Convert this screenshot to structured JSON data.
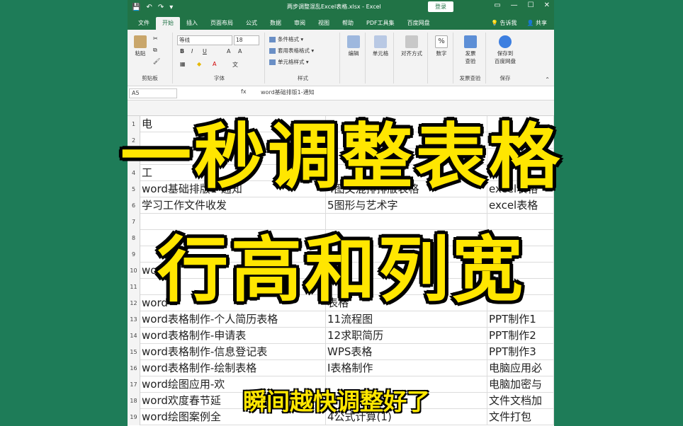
{
  "window": {
    "title": "两步调整混乱Excel表格.xlsx  -  Excel",
    "login_label": "登录",
    "controls": [
      "▭",
      "—",
      "☐",
      "✕"
    ]
  },
  "quick_access": [
    "💾",
    "↶",
    "↷",
    "▾"
  ],
  "tabs": [
    "文件",
    "开始",
    "插入",
    "页面布局",
    "公式",
    "数据",
    "审阅",
    "视图",
    "帮助",
    "PDF工具集",
    "百度网盘"
  ],
  "tabs_right": [
    "告诉我",
    "共享"
  ],
  "ribbon": {
    "clipboard": {
      "paste_label": "粘贴",
      "group_label": "剪贴板"
    },
    "font": {
      "font_name": "等线",
      "font_size": "18",
      "bold": "B",
      "italic": "I",
      "underline": "U",
      "a_up": "A",
      "a_down": "A",
      "group_label": "字体"
    },
    "styles": {
      "conditional": "条件格式",
      "table_format": "套用表格格式",
      "cell_styles": "单元格样式",
      "group_label": "样式"
    },
    "editing": {
      "label": "编辑"
    },
    "cells": {
      "label": "单元格"
    },
    "alignment": {
      "label": "对齐方式"
    },
    "number": {
      "label": "数字",
      "percent": "%"
    },
    "invoice": {
      "label_line1": "发票",
      "label_line2": "查验",
      "group_label": "发票查验"
    },
    "save_baidu": {
      "label_line1": "保存到",
      "label_line2": "百度网盘",
      "group_label": "保存"
    }
  },
  "formula_bar": {
    "namebox": "A5",
    "fx": "fx",
    "content": "word基础排版1-通知"
  },
  "grid": {
    "rows": [
      {
        "num": "1",
        "a": "电",
        "b": "",
        "c": ""
      },
      {
        "num": "2",
        "a": "",
        "b": "",
        "c": ""
      },
      {
        "num": "3",
        "a": "另",
        "b": "",
        "c": ""
      },
      {
        "num": "4",
        "a": "工",
        "b": "",
        "c": ""
      },
      {
        "num": "5",
        "a": "word基础排版1-通知",
        "b": "4图文混排排版表格",
        "c": "excel表格"
      },
      {
        "num": "6",
        "a": "学习工作文件收发",
        "b": "5图形与艺术字",
        "c": "excel表格"
      },
      {
        "num": "7",
        "a": "",
        "b": "",
        "c": ""
      },
      {
        "num": "8",
        "a": "",
        "b": "",
        "c": ""
      },
      {
        "num": "9",
        "a": "",
        "b": "",
        "c": ""
      },
      {
        "num": "10",
        "a": "wo",
        "b": "",
        "c": ""
      },
      {
        "num": "11",
        "a": "",
        "b": "",
        "c": ""
      },
      {
        "num": "12",
        "a": "word",
        "b": "表格",
        "c": ""
      },
      {
        "num": "13",
        "a": "word表格制作-个人简历表格",
        "b": "11流程图",
        "c": "PPT制作1"
      },
      {
        "num": "14",
        "a": "word表格制作-申请表",
        "b": "12求职简历",
        "c": "PPT制作2"
      },
      {
        "num": "15",
        "a": "word表格制作-信息登记表",
        "b": "WPS表格",
        "c": "PPT制作3"
      },
      {
        "num": "16",
        "a": "word表格制作-绘制表格",
        "b": "I表格制作",
        "c": "电脑应用必"
      },
      {
        "num": "17",
        "a": "word绘图应用-欢",
        "b": "",
        "c": "电脑加密与"
      },
      {
        "num": "18",
        "a": "word欢度春节延",
        "b": "",
        "c": "文件文档加"
      },
      {
        "num": "19",
        "a": "word绘图案例全",
        "b": "4公式计算(1)",
        "c": "文件打包"
      }
    ]
  },
  "overlay": {
    "headline_line1": "一秒调整表格",
    "headline_line2": "行高和列宽",
    "subtitle": "瞬间越快调整好了"
  }
}
